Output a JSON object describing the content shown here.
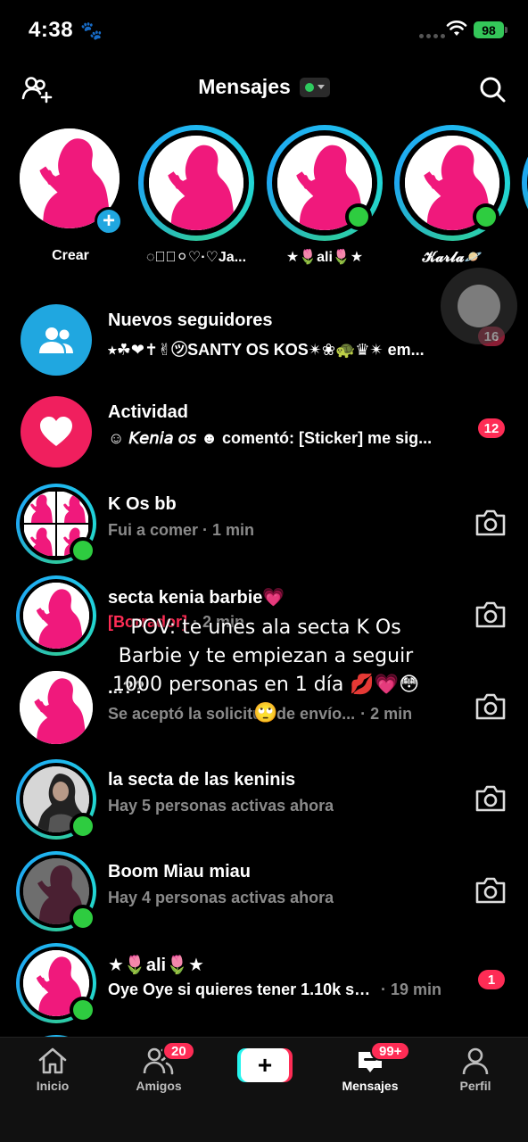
{
  "status_bar": {
    "time": "4:38",
    "battery": "98"
  },
  "header": {
    "title": "Mensajes"
  },
  "stories": [
    {
      "label": "Crear"
    },
    {
      "label": "◌⃝⍝⚪︎♡·♡Ja..."
    },
    {
      "label": "★🌷ali🌷★"
    },
    {
      "label": "𝓚𝓪𝓻𝓵𝓪🪐"
    }
  ],
  "rows": [
    {
      "name": "Nuevos seguidores",
      "sub": "⭒☘︎❤︎✝︎✌︎㋡SANTY OS KOS✴︎❀🐢♛✴︎ em...",
      "count": "16"
    },
    {
      "name": "Actividad",
      "sub": "☺︎ 𝘒𝘦𝘯𝘪𝘢 𝘰𝘴 ☻ comentó: [Sticker] me sig...",
      "count": "12"
    },
    {
      "name": "K Os bb",
      "sub": "Fui a comer · 1 min"
    },
    {
      "name": "secta kenia barbie💗",
      "sub_prefix": "[Borrador]",
      "sub": "· 2 min"
    },
    {
      "name": "...??",
      "sub": "Se aceptó la solicitud de envío...",
      "time": "· 2 min"
    },
    {
      "name": "la secta de las keninis",
      "sub": "Hay 5 personas activas ahora"
    },
    {
      "name": "Boom Miau miau",
      "sub": "Hay 4 personas activas ahora"
    },
    {
      "name": "★🌷ali🌷★",
      "sub": "Oye Oye si quieres tener 1.10k se...",
      "time": "· 19 min",
      "count": "1"
    }
  ],
  "caption": "POV: te unes ala secta K Os Barbie y te empiezan a seguir 1000 personas en 1 día 💋💗😳🙄",
  "nav": {
    "inicio": "Inicio",
    "amigos": "Amigos",
    "amigos_badge": "20",
    "mensajes": "Mensajes",
    "mensajes_badge": "99+",
    "perfil": "Perfil"
  },
  "colors": {
    "accent": "#fe2c55",
    "online": "#2ecc40",
    "ring": "#1fb6f0",
    "pink": "#f0197c"
  }
}
